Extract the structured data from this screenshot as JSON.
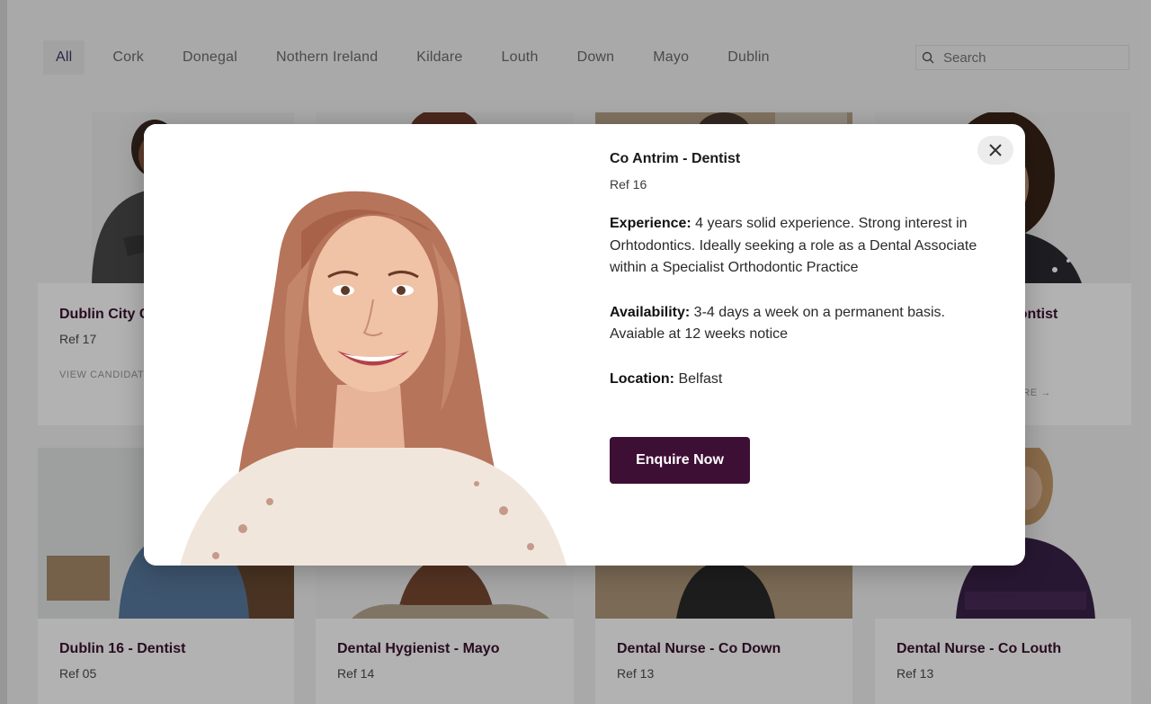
{
  "filters": [
    {
      "label": "All",
      "active": true
    },
    {
      "label": "Cork"
    },
    {
      "label": "Donegal"
    },
    {
      "label": "Nothern Ireland"
    },
    {
      "label": "Kildare"
    },
    {
      "label": "Louth"
    },
    {
      "label": "Down"
    },
    {
      "label": "Mayo"
    },
    {
      "label": "Dublin"
    }
  ],
  "search": {
    "placeholder": "Search"
  },
  "cards": [
    {
      "title": "Dublin City C",
      "ref": "Ref 17",
      "link": "VIEW CANDIDAT"
    },
    {
      "title": "dontist",
      "ref": "",
      "link": "UIRE →"
    },
    {
      "title": "Dublin 16 - Dentist",
      "ref": "Ref 05"
    },
    {
      "title": "Dental Hygienist - Mayo",
      "ref": "Ref 14"
    },
    {
      "title": "Dental Nurse - Co Down",
      "ref": "Ref 13"
    },
    {
      "title": "Dental Nurse - Co Louth",
      "ref": "Ref 13"
    }
  ],
  "modal": {
    "title": "Co Antrim - Dentist",
    "ref": "Ref 16",
    "experience_label": "Experience:",
    "experience_text": " 4 years solid experience. Strong interest in Orhtodontics. Ideally seeking a role as a Dental Associate within a Specialist Orthodontic Practice",
    "availability_label": "Availability:",
    "availability_text": " 3-4 days a week on a permanent basis. Avaiable at 12 weeks notice",
    "location_label": "Location:",
    "location_text": " Belfast",
    "button_label": "Enquire Now"
  },
  "colors": {
    "brand": "#3d0f35",
    "card_title": "#3a1230",
    "overlay": "rgba(0,0,0,0.30)"
  },
  "icons": {
    "search": "search-icon",
    "close": "close-icon",
    "arrow": "arrow-right-icon"
  }
}
